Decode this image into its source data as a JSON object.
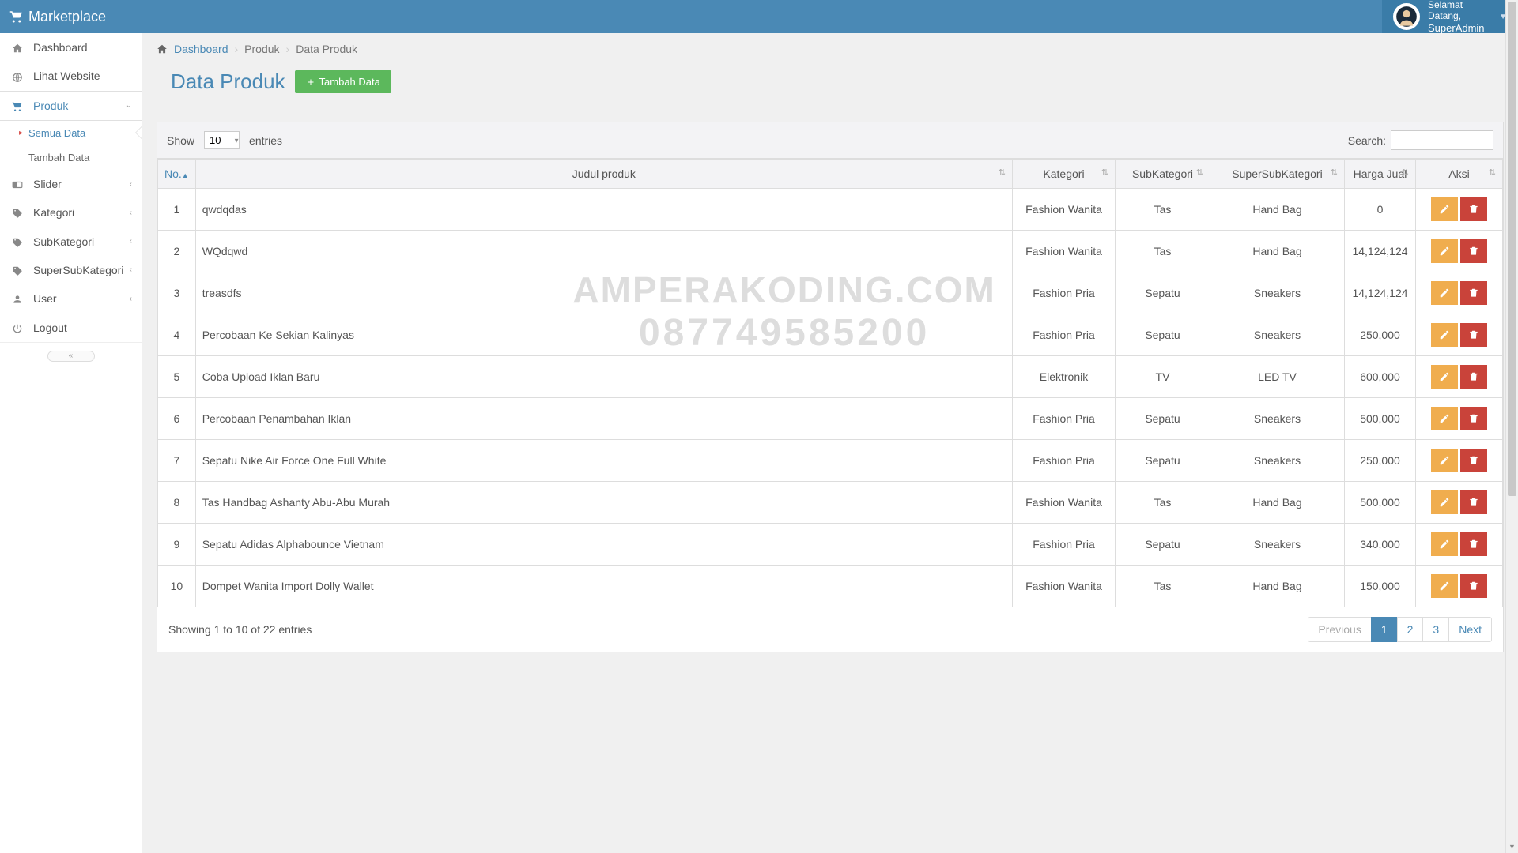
{
  "header": {
    "brand": "Marketplace",
    "welcome": "Selamat Datang,",
    "username": "SuperAdmin"
  },
  "sidebar": {
    "items": [
      {
        "icon": "dashboard",
        "label": "Dashboard",
        "expandable": false
      },
      {
        "icon": "globe",
        "label": "Lihat Website",
        "expandable": false
      },
      {
        "icon": "cart",
        "label": "Produk",
        "expandable": true,
        "active": true,
        "children": [
          {
            "label": "Semua Data",
            "active": true
          },
          {
            "label": "Tambah Data"
          }
        ]
      },
      {
        "icon": "slider",
        "label": "Slider",
        "expandable": true
      },
      {
        "icon": "tags",
        "label": "Kategori",
        "expandable": true
      },
      {
        "icon": "tags",
        "label": "SubKategori",
        "expandable": true
      },
      {
        "icon": "tags",
        "label": "SuperSubKategori",
        "expandable": true
      },
      {
        "icon": "user",
        "label": "User",
        "expandable": true
      },
      {
        "icon": "power",
        "label": "Logout",
        "expandable": false
      }
    ]
  },
  "breadcrumb": {
    "home": "Dashboard",
    "middle": "Produk",
    "current": "Data Produk"
  },
  "page": {
    "title": "Data Produk",
    "add_button": "Tambah Data"
  },
  "table": {
    "show_label": "Show",
    "entries_label": "entries",
    "per_page": "10",
    "search_label": "Search:",
    "columns": [
      "No.",
      "Judul produk",
      "Kategori",
      "SubKategori",
      "SuperSubKategori",
      "Harga Jual",
      "Aksi"
    ],
    "rows": [
      {
        "no": "1",
        "judul": "qwdqdas",
        "kategori": "Fashion Wanita",
        "sub": "Tas",
        "super": "Hand Bag",
        "harga": "0"
      },
      {
        "no": "2",
        "judul": "WQdqwd",
        "kategori": "Fashion Wanita",
        "sub": "Tas",
        "super": "Hand Bag",
        "harga": "14,124,124"
      },
      {
        "no": "3",
        "judul": "treasdfs",
        "kategori": "Fashion Pria",
        "sub": "Sepatu",
        "super": "Sneakers",
        "harga": "14,124,124"
      },
      {
        "no": "4",
        "judul": "Percobaan Ke Sekian Kalinyas",
        "kategori": "Fashion Pria",
        "sub": "Sepatu",
        "super": "Sneakers",
        "harga": "250,000"
      },
      {
        "no": "5",
        "judul": "Coba Upload Iklan Baru",
        "kategori": "Elektronik",
        "sub": "TV",
        "super": "LED TV",
        "harga": "600,000"
      },
      {
        "no": "6",
        "judul": "Percobaan Penambahan Iklan",
        "kategori": "Fashion Pria",
        "sub": "Sepatu",
        "super": "Sneakers",
        "harga": "500,000"
      },
      {
        "no": "7",
        "judul": "Sepatu Nike Air Force One Full White",
        "kategori": "Fashion Pria",
        "sub": "Sepatu",
        "super": "Sneakers",
        "harga": "250,000"
      },
      {
        "no": "8",
        "judul": "Tas Handbag Ashanty Abu-Abu Murah",
        "kategori": "Fashion Wanita",
        "sub": "Tas",
        "super": "Hand Bag",
        "harga": "500,000"
      },
      {
        "no": "9",
        "judul": "Sepatu Adidas Alphabounce Vietnam",
        "kategori": "Fashion Pria",
        "sub": "Sepatu",
        "super": "Sneakers",
        "harga": "340,000"
      },
      {
        "no": "10",
        "judul": "Dompet Wanita Import Dolly Wallet",
        "kategori": "Fashion Wanita",
        "sub": "Tas",
        "super": "Hand Bag",
        "harga": "150,000"
      }
    ],
    "footer_info": "Showing 1 to 10 of 22 entries",
    "pagination": {
      "previous": "Previous",
      "pages": [
        "1",
        "2",
        "3"
      ],
      "next": "Next",
      "active": "1"
    }
  },
  "watermark": {
    "line1": "AMPERAKODING.COM",
    "line2": "087749585200"
  }
}
